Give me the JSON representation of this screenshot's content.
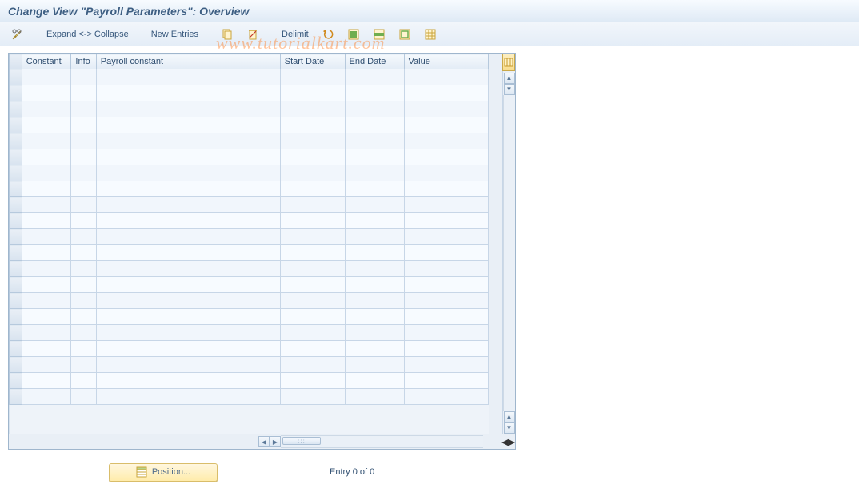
{
  "title": "Change View \"Payroll Parameters\": Overview",
  "toolbar": {
    "expand_collapse": "Expand <-> Collapse",
    "new_entries": "New Entries",
    "delimit": "Delimit"
  },
  "table": {
    "columns": {
      "constant": "Constant",
      "info": "Info",
      "payroll_constant": "Payroll constant",
      "start_date": "Start Date",
      "end_date": "End Date",
      "value": "Value"
    },
    "row_count": 21
  },
  "footer": {
    "position": "Position...",
    "entry": "Entry 0 of 0"
  },
  "watermark": "www.tutorialkart.com"
}
